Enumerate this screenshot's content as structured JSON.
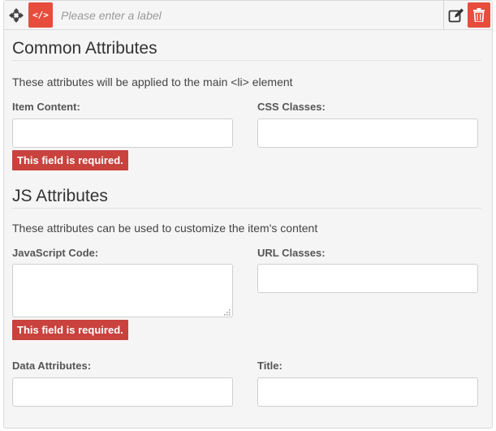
{
  "toolbar": {
    "move_icon": "move-arrows-icon",
    "code_icon": "code-icon",
    "code_glyph": "</>",
    "label_placeholder": "Please enter a label",
    "label_value": "",
    "edit_icon": "edit-icon",
    "delete_icon": "trash-icon"
  },
  "common": {
    "heading": "Common Attributes",
    "description": "These attributes will be applied to the main <li> element",
    "item_content": {
      "label": "Item Content:",
      "value": "",
      "error": "This field is required."
    },
    "css_classes": {
      "label": "CSS Classes:",
      "value": ""
    }
  },
  "js": {
    "heading": "JS Attributes",
    "description": "These attributes can be used to customize the item's content",
    "javascript_code": {
      "label": "JavaScript Code:",
      "value": "",
      "error": "This field is required."
    },
    "url_classes": {
      "label": "URL Classes:",
      "value": ""
    },
    "data_attributes": {
      "label": "Data Attributes:",
      "value": ""
    },
    "title": {
      "label": "Title:",
      "value": ""
    }
  },
  "colors": {
    "accent_red": "#e74c3c",
    "error_red": "#c9423e",
    "panel_bg": "#f5f5f5"
  }
}
